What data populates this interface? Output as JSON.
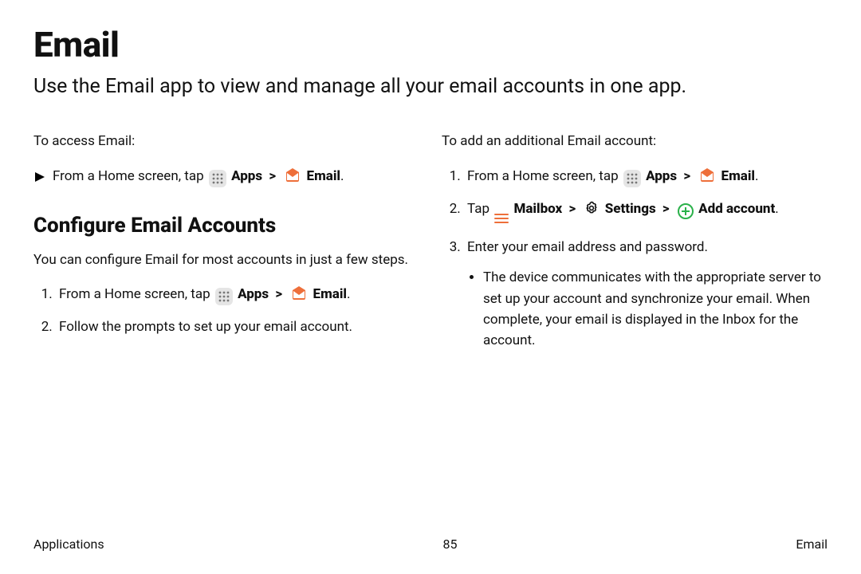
{
  "title": "Email",
  "lead": "Use the Email app to view and manage all your email accounts in one app.",
  "left": {
    "access_label": "To access Email:",
    "access_step_a": "From a Home screen, tap",
    "access_apps": "Apps",
    "access_email": "Email",
    "h2": "Configure Email Accounts",
    "h2_body": "You can configure Email for most accounts in just a few steps.",
    "li1_a": "From a Home screen, tap",
    "li1_apps": "Apps",
    "li1_email": "Email",
    "li2": "Follow the prompts to set up your email account."
  },
  "right": {
    "add_label": "To add an additional Email account:",
    "li1_a": "From a Home screen, tap",
    "li1_apps": "Apps",
    "li1_email": "Email",
    "li2_a": "Tap",
    "li2_mailbox": "Mailbox",
    "li2_settings": "Settings",
    "li2_addaccount": "Add account",
    "li3": "Enter your email address and password.",
    "li3_sub": "The device communicates with the appropriate server to set up your account and synchronize your email. When complete, your email is displayed in the Inbox for the account."
  },
  "footer": {
    "left": "Applications",
    "center": "85",
    "right": "Email"
  },
  "sep": ">",
  "dot": "."
}
